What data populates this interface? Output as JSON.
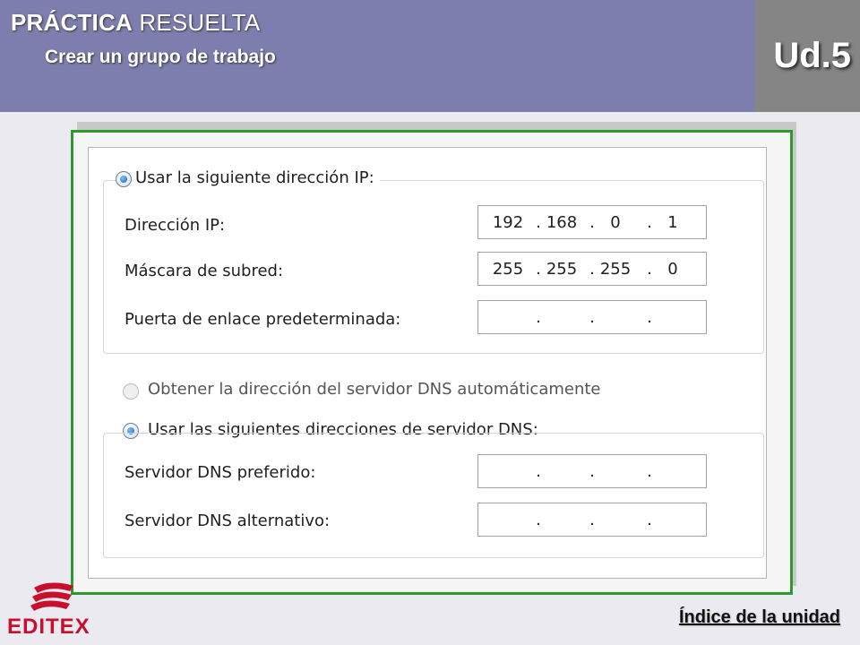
{
  "header": {
    "title_bold": "PRÁCTICA",
    "title_rest": "RESUELTA",
    "subtitle": "Crear un grupo de trabajo",
    "unit": "Ud.5"
  },
  "dialog": {
    "radio_use_ip": "Usar la siguiente dirección IP:",
    "ip_label": "Dirección IP:",
    "ip_value": [
      "192",
      "168",
      "0",
      "1"
    ],
    "mask_label": "Máscara de subred:",
    "mask_value": [
      "255",
      "255",
      "255",
      "0"
    ],
    "gateway_label": "Puerta de enlace predeterminada:",
    "gateway_value": [
      "",
      "",
      "",
      ""
    ],
    "radio_dns_auto": "Obtener la dirección del servidor DNS automáticamente",
    "radio_dns_manual": "Usar las siguientes direcciones de servidor DNS:",
    "dns_pref_label": "Servidor DNS preferido:",
    "dns_pref_value": [
      "",
      "",
      "",
      ""
    ],
    "dns_alt_label": "Servidor DNS alternativo:",
    "dns_alt_value": [
      "",
      "",
      "",
      ""
    ],
    "dot": "."
  },
  "footer": {
    "logo": "EDITEX",
    "index_link": "Índice de la unidad"
  },
  "colors": {
    "header_bg": "#7e7eae",
    "unit_bg": "#858585",
    "frame_green": "#2e9a2e",
    "logo_red": "#c8102e"
  }
}
